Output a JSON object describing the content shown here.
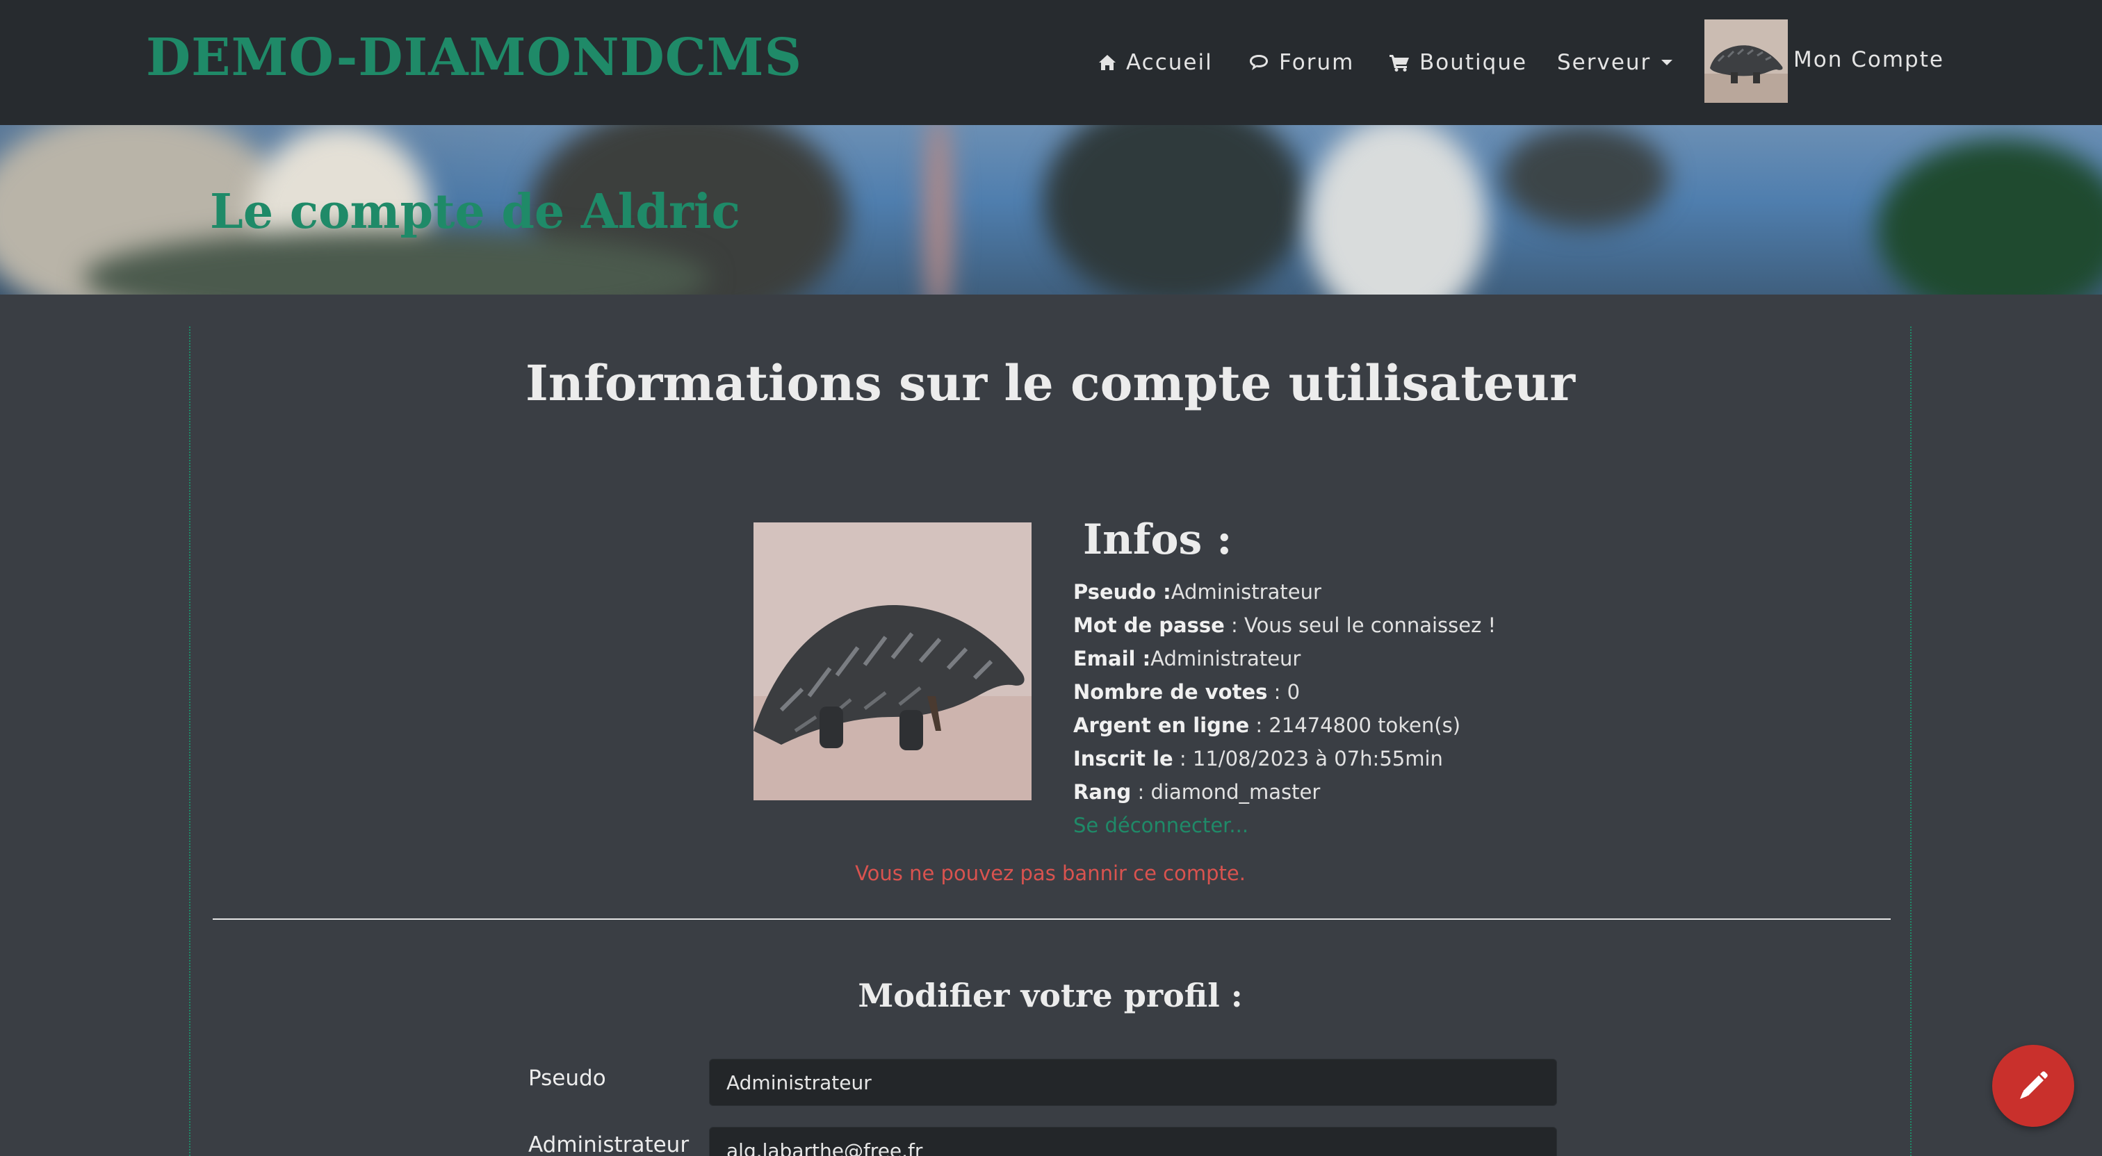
{
  "navbar": {
    "brand": "DEMO-DIAMONDCMS",
    "items": [
      {
        "label": "Accueil",
        "icon": "home-icon"
      },
      {
        "label": "Forum",
        "icon": "chat-icon"
      },
      {
        "label": "Boutique",
        "icon": "cart-icon"
      },
      {
        "label": "Serveur",
        "icon": "caret-down-icon"
      }
    ],
    "account_label": "Mon Compte"
  },
  "hero": {
    "title": "Le compte de Aldric"
  },
  "main": {
    "title": "Informations sur le compte utilisateur",
    "infos_title": "Infos :",
    "info": [
      {
        "label": "Pseudo :",
        "value": "Administrateur"
      },
      {
        "label": "Mot de passe",
        "value": " : Vous seul le connaissez !"
      },
      {
        "label": "Email :",
        "value": "Administrateur"
      },
      {
        "label": "Nombre de votes",
        "value": " : 0"
      },
      {
        "label": "Argent en ligne",
        "value": " : 21474800 token(s)"
      },
      {
        "label": "Inscrit le",
        "value": " : 11/08/2023 à 07h:55min"
      },
      {
        "label": "Rang",
        "value": " : diamond_master"
      }
    ],
    "logout_label": "Se déconnecter...",
    "ban_message": "Vous ne pouvez pas bannir ce compte.",
    "edit_title": "Modifier votre profil :",
    "form": {
      "pseudo_label": "Pseudo",
      "pseudo_value": "Administrateur",
      "email_label": "Administrateur",
      "email_value": "alg.labarthe@free.fr"
    }
  },
  "colors": {
    "accent": "#1f8a68",
    "navbar_bg": "#272b2f",
    "page_bg": "#3a3e44",
    "danger": "#d9534f",
    "fab": "#c9302c"
  }
}
